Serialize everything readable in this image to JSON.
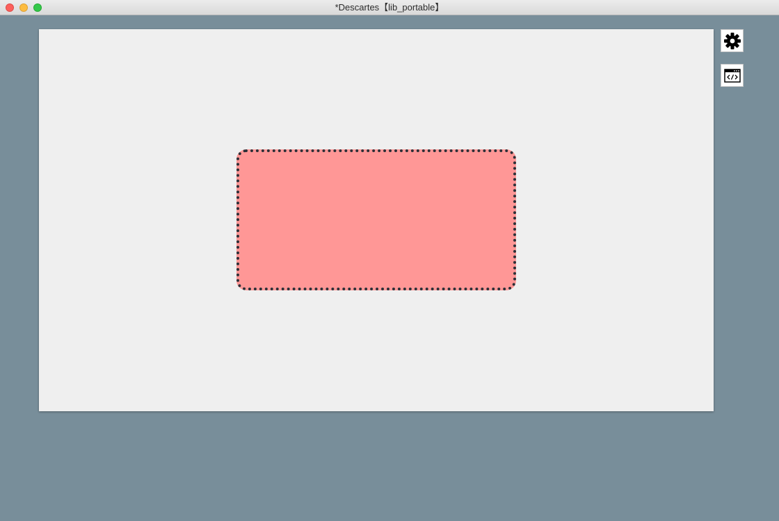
{
  "window": {
    "title": "*Descartes【lib_portable】"
  },
  "canvas": {
    "shape": {
      "fill_color": "#ff9796",
      "border_color": "#2b3038",
      "border_style": "dotted"
    }
  },
  "toolbar": {
    "settings_icon": "gear-icon",
    "code_icon": "code-window-icon"
  },
  "colors": {
    "background": "#788e9a",
    "canvas": "#efefef"
  }
}
